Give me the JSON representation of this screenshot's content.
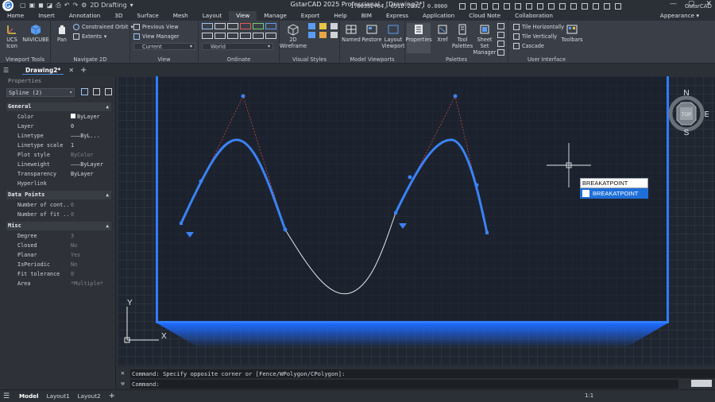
{
  "titlebar": {
    "title": "GstarCAD 2025 Professional - [Drawing2*]",
    "workspace": "2D Drafting",
    "workspace_icon": "gear-icon"
  },
  "menu": {
    "tabs": [
      "Home",
      "Insert",
      "Annotation",
      "3D",
      "Surface",
      "Mesh",
      "Layout",
      "View",
      "Manage",
      "Export",
      "Help",
      "BIM",
      "Express",
      "Application",
      "Cloud Note",
      "Collaboration"
    ],
    "active": "View",
    "appearance": "Appearance"
  },
  "ribbon": {
    "viewport_tools": {
      "label": "Viewport Tools",
      "ucs_icon": "UCS Icon",
      "navicube": "NAVICUBE"
    },
    "navigate2d": {
      "label": "Navigate 2D",
      "pan": "Pan",
      "constrained_orbit": "Constrained Orbit",
      "extents": "Extents"
    },
    "view": {
      "label": "View",
      "previous_view": "Previous View",
      "view_manager": "View Manager",
      "current": "Current"
    },
    "ordinate": {
      "label": "Ordinate",
      "world": "World"
    },
    "visual_styles": {
      "label": "Visual Styles",
      "wireframe": "2D Wireframe"
    },
    "model_viewports": {
      "label": "Model Viewports",
      "named": "Named",
      "restore": "Restore",
      "layout_viewport": "Layout Viewport"
    },
    "palettes": {
      "label": "Palettes",
      "properties": "Properties",
      "xref": "Xref",
      "tool_palettes": "Tool Palettes",
      "sheet_set_manager": "Sheet Set Manager"
    },
    "user_interface": {
      "label": "User Interface",
      "tile_h": "Tile Horizontally",
      "tile_v": "Tile Vertically",
      "cascade": "Cascade",
      "toolbars": "Toolbars"
    }
  },
  "document": {
    "tab": "Drawing2*"
  },
  "properties": {
    "title": "Properties",
    "selection": "Spline (2)",
    "general": {
      "header": "General",
      "rows": [
        {
          "k": "Color",
          "v": "ByLayer"
        },
        {
          "k": "Layer",
          "v": "0"
        },
        {
          "k": "Linetype",
          "v": "———ByL..."
        },
        {
          "k": "Linetype scale",
          "v": "1"
        },
        {
          "k": "Plot style",
          "v": "ByColor"
        },
        {
          "k": "Lineweight",
          "v": "———ByLayer"
        },
        {
          "k": "Transparency",
          "v": "ByLayer"
        },
        {
          "k": "Hyperlink",
          "v": ""
        }
      ]
    },
    "data_points": {
      "header": "Data Points",
      "rows": [
        {
          "k": "Number of cont...",
          "v": "6"
        },
        {
          "k": "Number of fit ...",
          "v": "0"
        }
      ]
    },
    "misc": {
      "header": "Misc",
      "rows": [
        {
          "k": "Degree",
          "v": "3"
        },
        {
          "k": "Closed",
          "v": "No"
        },
        {
          "k": "Planar",
          "v": "Yes"
        },
        {
          "k": "IsPeriodic",
          "v": "No"
        },
        {
          "k": "Fit tolerance",
          "v": "0"
        },
        {
          "k": "Area",
          "v": "*Multiple*"
        }
      ]
    }
  },
  "viewcube": {
    "top": "TOP",
    "n": "N",
    "s": "S",
    "e": "E"
  },
  "ucs": {
    "x": "X",
    "y": "Y"
  },
  "tooltip": {
    "input": "BREAKATPOINT",
    "option": "BREAKATPOINT"
  },
  "command": {
    "history": "Command: Specify opposite corner or [Fence/WPolygon/CPolygon]:",
    "prompt": "Command:"
  },
  "status": {
    "tabs": [
      "Model",
      "Layout1",
      "Layout2"
    ],
    "active": "Model",
    "coords": "1.6635E+04, 6512.2832, 0.0000",
    "scale": "1:1",
    "brand": "GstarCAD"
  },
  "colors": {
    "accent": "#2f7dff",
    "selection": "#1e6fd9",
    "curve": "#3b82f6"
  }
}
